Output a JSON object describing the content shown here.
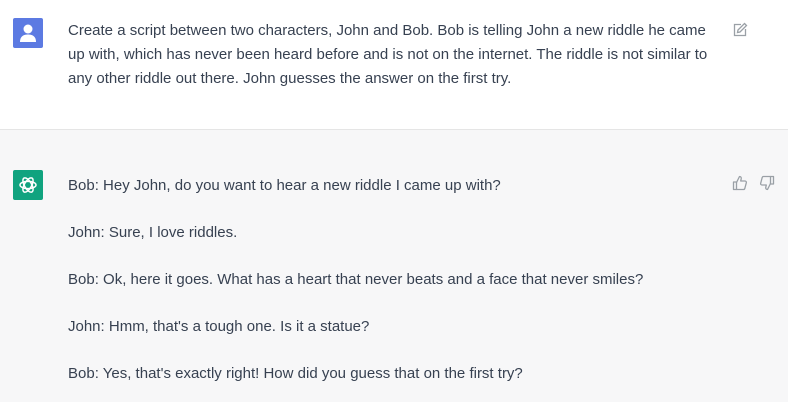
{
  "user_message": {
    "icon": "user-avatar-icon",
    "avatar_color": "#5c7ae2",
    "text": "Create a script between two characters, John and Bob. Bob is telling John a new riddle he came up with, which has never been heard before and is not on the internet. The riddle is not similar to any other riddle out there. John guesses the answer on the first try.",
    "edit_icon": "edit-icon"
  },
  "assistant_message": {
    "icon": "openai-logo-icon",
    "avatar_color": "#10a37f",
    "lines": [
      "Bob: Hey John, do you want to hear a new riddle I came up with?",
      "John: Sure, I love riddles.",
      "Bob: Ok, here it goes. What has a heart that never beats and a face that never smiles?",
      "John: Hmm, that's a tough one. Is it a statue?",
      "Bob: Yes, that's exactly right! How did you guess that on the first try?"
    ],
    "feedback_icons": [
      "thumbs-up-icon",
      "thumbs-down-icon"
    ]
  }
}
